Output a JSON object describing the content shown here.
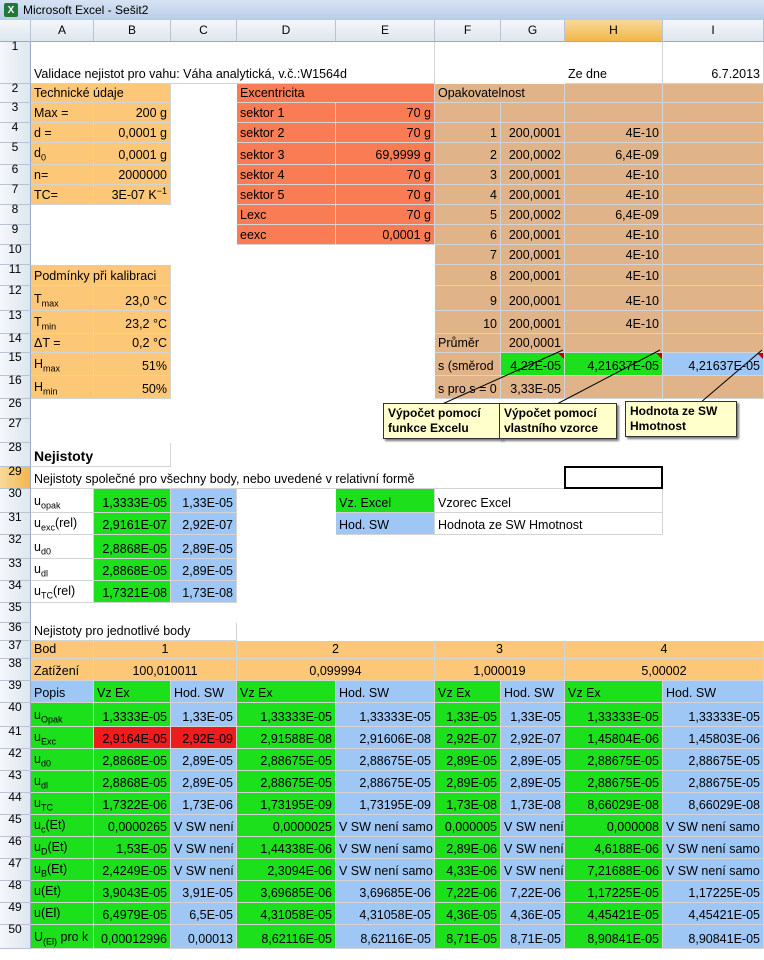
{
  "window": {
    "title": "Microsoft Excel - Sešit2",
    "app_icon": "excel-icon"
  },
  "columns": [
    "A",
    "B",
    "C",
    "D",
    "E",
    "F",
    "G",
    "H",
    "I"
  ],
  "selected_column": "H",
  "selected_row": "29",
  "row_numbers": [
    "1",
    "2",
    "3",
    "4",
    "5",
    "6",
    "7",
    "8",
    "9",
    "10",
    "11",
    "12",
    "13",
    "14",
    "15",
    "16",
    "26",
    "27",
    "28",
    "29",
    "30",
    "31",
    "32",
    "33",
    "34",
    "35",
    "36",
    "37",
    "38",
    "39",
    "40",
    "41",
    "42",
    "43",
    "44",
    "45",
    "46",
    "47",
    "48",
    "49",
    "50"
  ],
  "r1": {
    "a": "Validace nejistot pro vahu: Váha analytická, v.č.:W1564d",
    "h": "Ze dne",
    "i": "6.7.2013"
  },
  "tech": {
    "header": "Technické údaje",
    "labels": [
      "Max =",
      "d =",
      "d",
      "n=",
      "TC="
    ],
    "sub_d0": "0",
    "values": [
      "200 g",
      "0,0001 g",
      "0,0001 g",
      "2000000",
      "3E-07  K"
    ],
    "tc_sup": "−1"
  },
  "exc": {
    "header": "Excentricita",
    "labels": [
      "sektor 1",
      "sektor 2",
      "sektor 3",
      "sektor 4",
      "sektor 5",
      "Lexc",
      "eexc"
    ],
    "values": [
      "70 g",
      "70 g",
      "69,9999 g",
      "70 g",
      "70 g",
      "70 g",
      "0,0001 g"
    ]
  },
  "opak": {
    "header": "Opakovatelnost",
    "rows": [
      [
        "1",
        "200,0001",
        "4E-10"
      ],
      [
        "2",
        "200,0002",
        "6,4E-09"
      ],
      [
        "3",
        "200,0001",
        "4E-10"
      ],
      [
        "4",
        "200,0001",
        "4E-10"
      ],
      [
        "5",
        "200,0002",
        "6,4E-09"
      ],
      [
        "6",
        "200,0001",
        "4E-10"
      ],
      [
        "7",
        "200,0001",
        "4E-10"
      ],
      [
        "8",
        "200,0001",
        "4E-10"
      ],
      [
        "9",
        "200,0001",
        "4E-10"
      ],
      [
        "10",
        "200,0001",
        "4E-10"
      ]
    ],
    "prumer_label": "Průměr",
    "prumer": "200,0001",
    "s_label": "s (směrod",
    "s_excel": "4,22E-05",
    "s_formula": "4,21637E-05",
    "s_sw": "4,21637E-05",
    "s0_label": "s pro s = 0",
    "s0": "3,33E-05"
  },
  "kal": {
    "header": "Podmínky při kalibraci",
    "labels": [
      "T",
      "T",
      "ΔT =",
      "H",
      "H"
    ],
    "subs": [
      "max",
      "min",
      "",
      "max",
      "min"
    ],
    "values": [
      "23,0 °C",
      "23,2 °C",
      "0,2 °C",
      "51%",
      "50%"
    ]
  },
  "callouts": [
    "Výpočet pomocí funkce Excelu",
    "Výpočet pomocí vlastního vzorce",
    "Hodnota ze SW Hmotnost"
  ],
  "nejistoty": {
    "title": "Nejistoty",
    "subtitle": "Nejistoty společné pro všechny body, nebo uvedené v relativní formě",
    "labels": [
      "u",
      "u",
      "u",
      "u",
      "u"
    ],
    "subs": [
      "opak",
      "exc",
      "d0",
      "dl",
      "TC"
    ],
    "suffix": [
      "",
      "(rel)",
      "",
      "",
      "(rel)"
    ],
    "excel": [
      "1,3333E-05",
      "2,9161E-07",
      "2,8868E-05",
      "2,8868E-05",
      "1,7321E-08"
    ],
    "sw": [
      "1,33E-05",
      "2,92E-07",
      "2,89E-05",
      "2,89E-05",
      "1,73E-08"
    ],
    "legend_excel_tag": "Vz. Excel",
    "legend_excel": "Vzorec Excel",
    "legend_sw_tag": "Hod. SW",
    "legend_sw": "Hodnota ze SW Hmotnost"
  },
  "body": {
    "title": "Nejistoty pro jednotlivé body",
    "bod_label": "Bod",
    "bods": [
      "1",
      "2",
      "3",
      "4"
    ],
    "zat_label": "Zatížení",
    "zats": [
      "100,010011",
      "0,099994",
      "1,000019",
      "5,00002"
    ],
    "popis": "Popis",
    "vzex": "Vz Ex",
    "hodsw": "Hod. SW",
    "rows": [
      {
        "l": "u",
        "s": "Opak",
        "x": "",
        "v": [
          "1,3333E-05",
          "1,33E-05",
          "1,33333E-05",
          "1,33333E-05",
          "1,33E-05",
          "1,33E-05",
          "1,33333E-05",
          "1,33333E-05"
        ]
      },
      {
        "l": "u",
        "s": "Exc",
        "x": "",
        "v": [
          "2,9164E-05",
          "2,92E-09",
          "2,91588E-08",
          "2,91606E-08",
          "2,92E-07",
          "2,92E-07",
          "1,45804E-06",
          "1,45803E-06"
        ]
      },
      {
        "l": "u",
        "s": "d0",
        "x": "",
        "v": [
          "2,8868E-05",
          "2,89E-05",
          "2,88675E-05",
          "2,88675E-05",
          "2,89E-05",
          "2,89E-05",
          "2,88675E-05",
          "2,88675E-05"
        ]
      },
      {
        "l": "u",
        "s": "dl",
        "x": "",
        "v": [
          "2,8868E-05",
          "2,89E-05",
          "2,88675E-05",
          "2,88675E-05",
          "2,89E-05",
          "2,89E-05",
          "2,88675E-05",
          "2,88675E-05"
        ]
      },
      {
        "l": "u",
        "s": "TC",
        "x": "",
        "v": [
          "1,7322E-06",
          "1,73E-06",
          "1,73195E-09",
          "1,73195E-09",
          "1,73E-08",
          "1,73E-08",
          "8,66029E-08",
          "8,66029E-08"
        ]
      },
      {
        "l": "u",
        "s": "c",
        "x": "(Et)",
        "v": [
          "0,0000265",
          "V SW není",
          "0,0000025",
          "V SW není samo",
          "0,000005",
          "V SW není",
          "0,000008",
          "V SW není samo"
        ]
      },
      {
        "l": "u",
        "s": "D",
        "x": "(Et)",
        "v": [
          "1,53E-05",
          "V SW není",
          "1,44338E-06",
          "V SW není samo",
          "2,89E-06",
          "V SW není",
          "4,6188E-06",
          "V SW není samo"
        ]
      },
      {
        "l": "u",
        "s": "B",
        "x": "(Et)",
        "v": [
          "2,4249E-05",
          "V SW není",
          "2,3094E-06",
          "V SW není samo",
          "4,33E-06",
          "V SW není",
          "7,21688E-06",
          "V SW není samo"
        ]
      },
      {
        "l": "u",
        "s": "",
        "x": "(Et)",
        "v": [
          "3,9043E-05",
          "3,91E-05",
          "3,69685E-06",
          "3,69685E-06",
          "7,22E-06",
          "7,22E-06",
          "1,17225E-05",
          "1,17225E-05"
        ]
      },
      {
        "l": "u",
        "s": "",
        "x": "(El)",
        "v": [
          "6,4979E-05",
          "6,5E-05",
          "4,31058E-05",
          "4,31058E-05",
          "4,36E-05",
          "4,36E-05",
          "4,45421E-05",
          "4,45421E-05"
        ]
      },
      {
        "l": "U",
        "s": "(El)",
        "x": " pro k",
        "v": [
          "0,00012996",
          "0,00013",
          "8,62116E-05",
          "8,62116E-05",
          "8,71E-05",
          "8,71E-05",
          "8,90841E-05",
          "8,90841E-05"
        ]
      }
    ]
  }
}
